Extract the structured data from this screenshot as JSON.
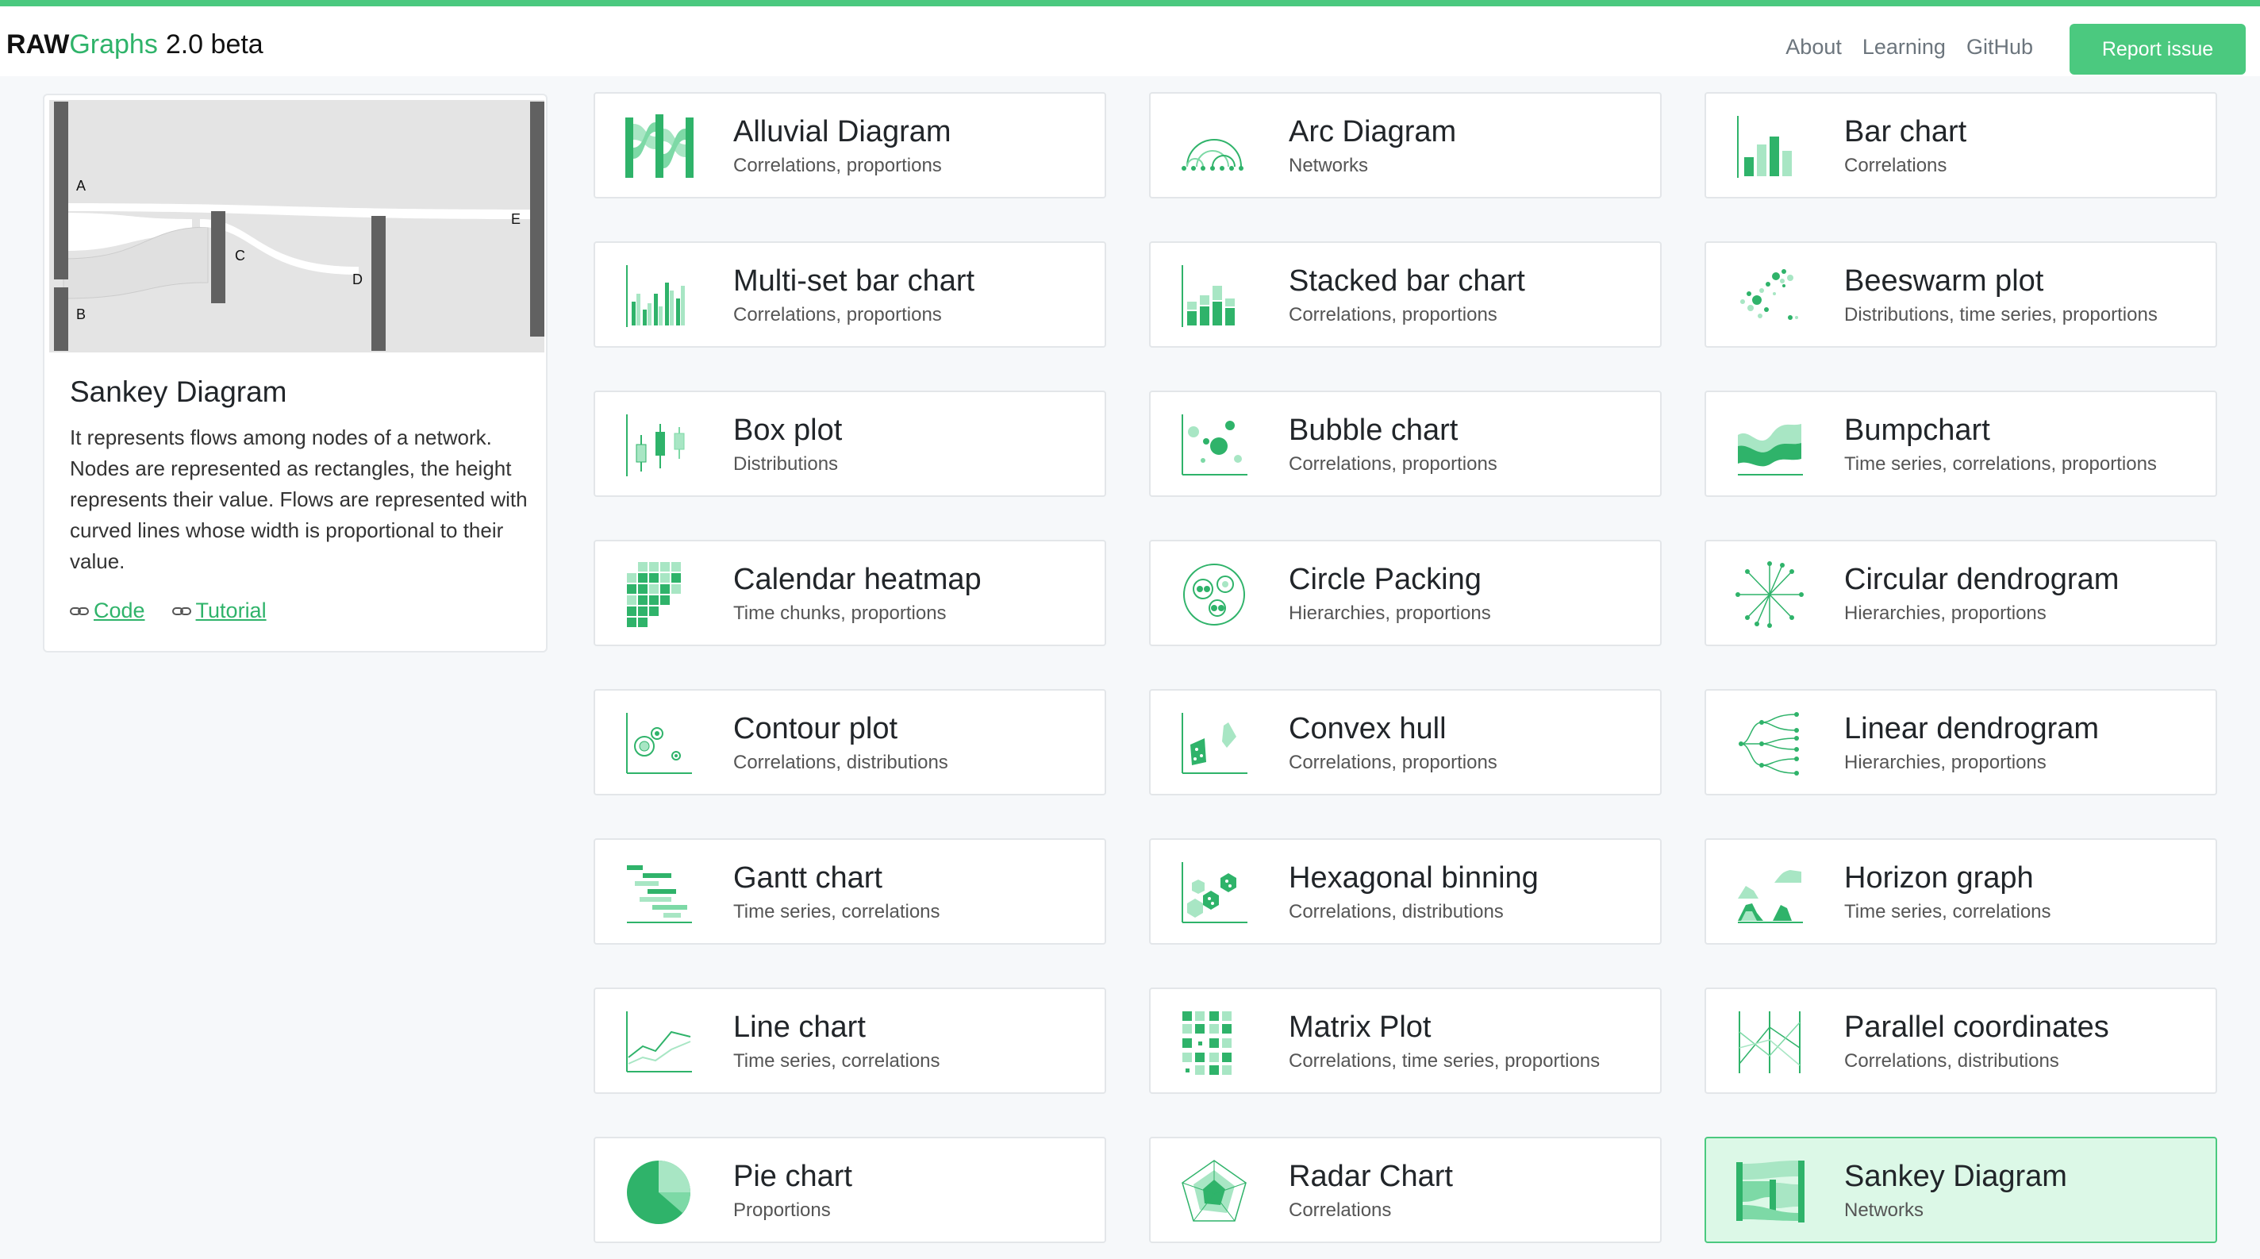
{
  "brand": {
    "raw": "RAW",
    "graphs": "Graphs",
    "version": "2.0 beta"
  },
  "nav": {
    "about": "About",
    "learning": "Learning",
    "github": "GitHub",
    "report": "Report issue"
  },
  "colors": {
    "accent": "#4bc97f",
    "accent_dark": "#2fb36a",
    "selected_bg": "#dcf8e7"
  },
  "selected_chart": {
    "title": "Sankey Diagram",
    "description": "It represents flows among nodes of a network. Nodes are represented as rectangles, the height represents their value. Flows are represented with curved lines whose width is proportional to their value.",
    "code_label": "Code",
    "tutorial_label": "Tutorial",
    "nodes": [
      "A",
      "B",
      "C",
      "D",
      "E"
    ]
  },
  "charts": [
    {
      "title": "Alluvial Diagram",
      "subtitle": "Correlations, proportions",
      "icon": "alluvial-icon"
    },
    {
      "title": "Arc Diagram",
      "subtitle": "Networks",
      "icon": "arc-icon"
    },
    {
      "title": "Bar chart",
      "subtitle": "Correlations",
      "icon": "bar-icon"
    },
    {
      "title": "Multi-set bar chart",
      "subtitle": "Correlations, proportions",
      "icon": "multiset-bar-icon"
    },
    {
      "title": "Stacked bar chart",
      "subtitle": "Correlations, proportions",
      "icon": "stacked-bar-icon"
    },
    {
      "title": "Beeswarm plot",
      "subtitle": "Distributions, time series, proportions",
      "icon": "beeswarm-icon"
    },
    {
      "title": "Box plot",
      "subtitle": "Distributions",
      "icon": "boxplot-icon"
    },
    {
      "title": "Bubble chart",
      "subtitle": "Correlations, proportions",
      "icon": "bubble-icon"
    },
    {
      "title": "Bumpchart",
      "subtitle": "Time series, correlations, proportions",
      "icon": "bumpchart-icon"
    },
    {
      "title": "Calendar heatmap",
      "subtitle": "Time chunks, proportions",
      "icon": "calendar-icon"
    },
    {
      "title": "Circle Packing",
      "subtitle": "Hierarchies, proportions",
      "icon": "circle-packing-icon"
    },
    {
      "title": "Circular dendrogram",
      "subtitle": "Hierarchies, proportions",
      "icon": "circular-dendrogram-icon"
    },
    {
      "title": "Contour plot",
      "subtitle": "Correlations, distributions",
      "icon": "contour-icon"
    },
    {
      "title": "Convex hull",
      "subtitle": "Correlations, proportions",
      "icon": "convex-hull-icon"
    },
    {
      "title": "Linear dendrogram",
      "subtitle": "Hierarchies, proportions",
      "icon": "linear-dendrogram-icon"
    },
    {
      "title": "Gantt chart",
      "subtitle": "Time series, correlations",
      "icon": "gantt-icon"
    },
    {
      "title": "Hexagonal binning",
      "subtitle": "Correlations, distributions",
      "icon": "hexbin-icon"
    },
    {
      "title": "Horizon graph",
      "subtitle": "Time series, correlations",
      "icon": "horizon-icon"
    },
    {
      "title": "Line chart",
      "subtitle": "Time series, correlations",
      "icon": "line-icon"
    },
    {
      "title": "Matrix Plot",
      "subtitle": "Correlations, time series, proportions",
      "icon": "matrix-icon"
    },
    {
      "title": "Parallel coordinates",
      "subtitle": "Correlations, distributions",
      "icon": "parallel-icon"
    },
    {
      "title": "Pie chart",
      "subtitle": "Proportions",
      "icon": "pie-icon"
    },
    {
      "title": "Radar Chart",
      "subtitle": "Correlations",
      "icon": "radar-icon"
    },
    {
      "title": "Sankey Diagram",
      "subtitle": "Networks",
      "icon": "sankey-icon",
      "selected": true
    }
  ]
}
